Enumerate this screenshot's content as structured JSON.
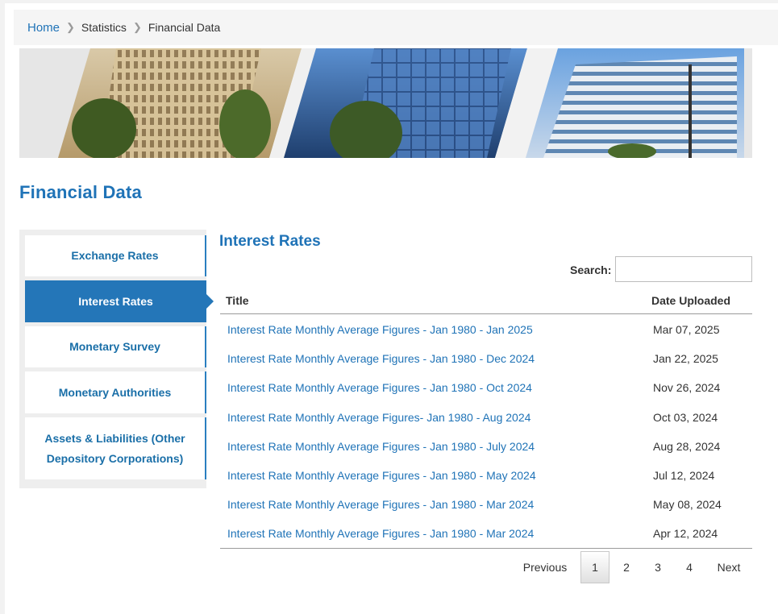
{
  "breadcrumb": {
    "home": "Home",
    "items": [
      "Statistics",
      "Financial Data"
    ]
  },
  "page_title": "Financial Data",
  "sidebar": {
    "items": [
      {
        "label": "Exchange Rates",
        "active": false
      },
      {
        "label": "Interest Rates",
        "active": true
      },
      {
        "label": "Monetary Survey",
        "active": false
      },
      {
        "label": "Monetary Authorities",
        "active": false
      },
      {
        "label": "Assets & Liabilities (Other Depository Corporations)",
        "active": false
      }
    ]
  },
  "section_title": "Interest Rates",
  "search": {
    "label": "Search:",
    "value": ""
  },
  "table": {
    "headers": {
      "title": "Title",
      "date": "Date Uploaded"
    },
    "rows": [
      {
        "title": "Interest Rate Monthly Average Figures - Jan 1980 - Jan 2025",
        "date": "Mar 07, 2025"
      },
      {
        "title": "Interest Rate Monthly Average Figures - Jan 1980 - Dec 2024",
        "date": "Jan 22, 2025"
      },
      {
        "title": "Interest Rate Monthly Average Figures - Jan 1980 - Oct 2024",
        "date": "Nov 26, 2024"
      },
      {
        "title": "Interest Rate Monthly Average Figures- Jan 1980 - Aug 2024",
        "date": "Oct 03, 2024"
      },
      {
        "title": "Interest Rate Monthly Average Figures - Jan 1980 - July 2024",
        "date": "Aug 28, 2024"
      },
      {
        "title": "Interest Rate Monthly Average Figures - Jan 1980 - May 2024",
        "date": "Jul 12, 2024"
      },
      {
        "title": "Interest Rate Monthly Average Figures - Jan 1980 - Mar 2024",
        "date": "May 08, 2024"
      },
      {
        "title": "Interest Rate Monthly Average Figures - Jan 1980 - Mar 2024",
        "date": "Apr 12, 2024"
      }
    ]
  },
  "pagination": {
    "previous": "Previous",
    "pages": [
      "1",
      "2",
      "3",
      "4"
    ],
    "current": "1",
    "next": "Next"
  },
  "colors": {
    "accent": "#1f73b7",
    "active_tab": "#2476b8"
  }
}
